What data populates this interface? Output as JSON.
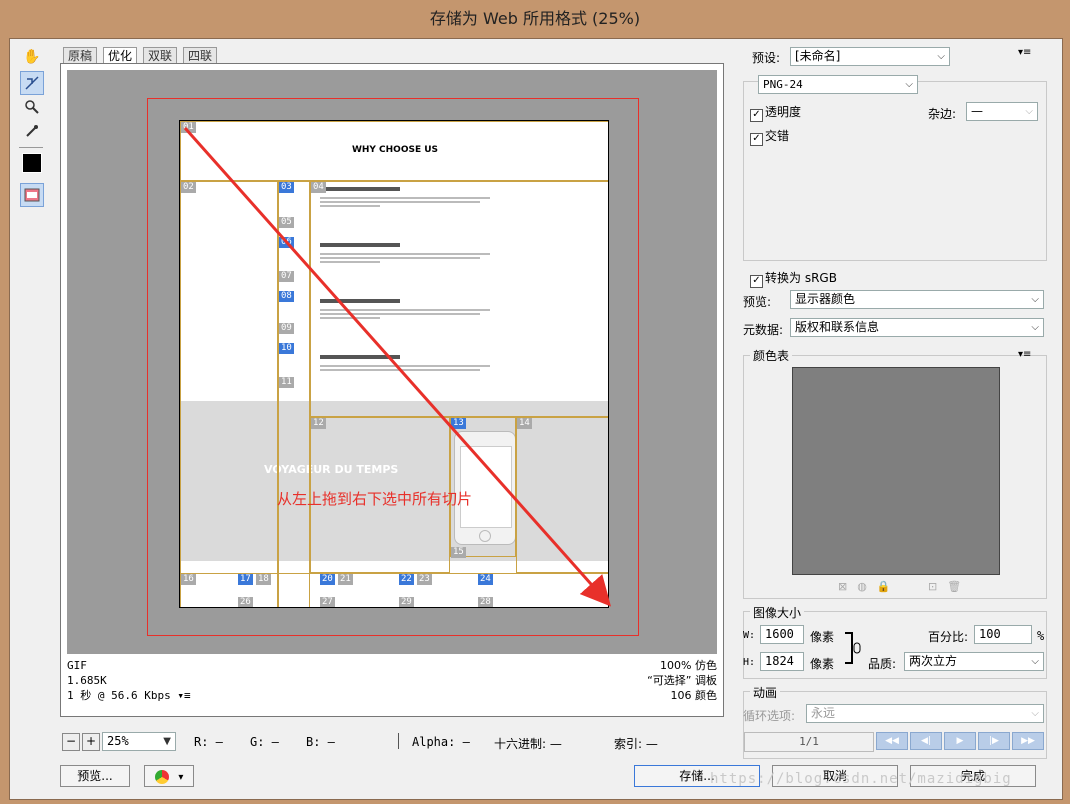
{
  "window": {
    "title": "存储为 Web 所用格式 (25%)"
  },
  "tabs": [
    "原稿",
    "优化",
    "双联",
    "四联"
  ],
  "canvas": {
    "page_heading": "WHY CHOOSE US",
    "banner_text": "VOYAGEUR DU TEMPS",
    "annotation": "从左上拖到右下选中所有切片",
    "slice_tags": [
      "01",
      "02",
      "03",
      "04",
      "05",
      "06",
      "07",
      "08",
      "09",
      "10",
      "11",
      "12",
      "13",
      "14",
      "15",
      "16",
      "17",
      "18",
      "20",
      "21",
      "22",
      "23",
      "24",
      "26",
      "27",
      "29",
      "28"
    ]
  },
  "info": {
    "format": "GIF",
    "size": "1.685K",
    "speed": "1 秒 @ 56.6 Kbps",
    "dither": "100% 仿色",
    "palette": "“可选择” 调板",
    "colors": "106 颜色"
  },
  "bottom_bar": {
    "zoom": "25%",
    "r": "R: —",
    "g": "G: —",
    "b": "B: —",
    "alpha": "Alpha: —",
    "hex": "十六进制: —",
    "index": "索引: —"
  },
  "buttons": {
    "preview": "预览...",
    "save": "存储...",
    "cancel": "取消",
    "done": "完成"
  },
  "watermark": "https://blog.csdn.net/mazidigbig",
  "settings": {
    "preset_label": "预设:",
    "preset_value": "[未命名]",
    "format_value": "PNG-24",
    "transparency": "透明度",
    "interlaced": "交错",
    "matte_label": "杂边:",
    "matte_value": "—",
    "convert_srgb": "转换为 sRGB",
    "preview_label": "预览:",
    "preview_value": "显示器颜色",
    "metadata_label": "元数据:",
    "metadata_value": "版权和联系信息"
  },
  "color_table": {
    "title": "颜色表"
  },
  "image_size": {
    "title": "图像大小",
    "w_label": "W:",
    "w_value": "1600",
    "h_label": "H:",
    "h_value": "1824",
    "unit": "像素",
    "percent_label": "百分比:",
    "percent_value": "100",
    "percent_unit": "%",
    "quality_label": "品质:",
    "quality_value": "两次立方"
  },
  "animation": {
    "title": "动画",
    "loop_label": "循环选项:",
    "loop_value": "永远",
    "frame": "1/1"
  },
  "colors": {
    "titlebar": "#c4966e",
    "selection_blue": "#3a78d9",
    "slice_border": "#c9a244",
    "arrow_red": "#e8302a"
  }
}
